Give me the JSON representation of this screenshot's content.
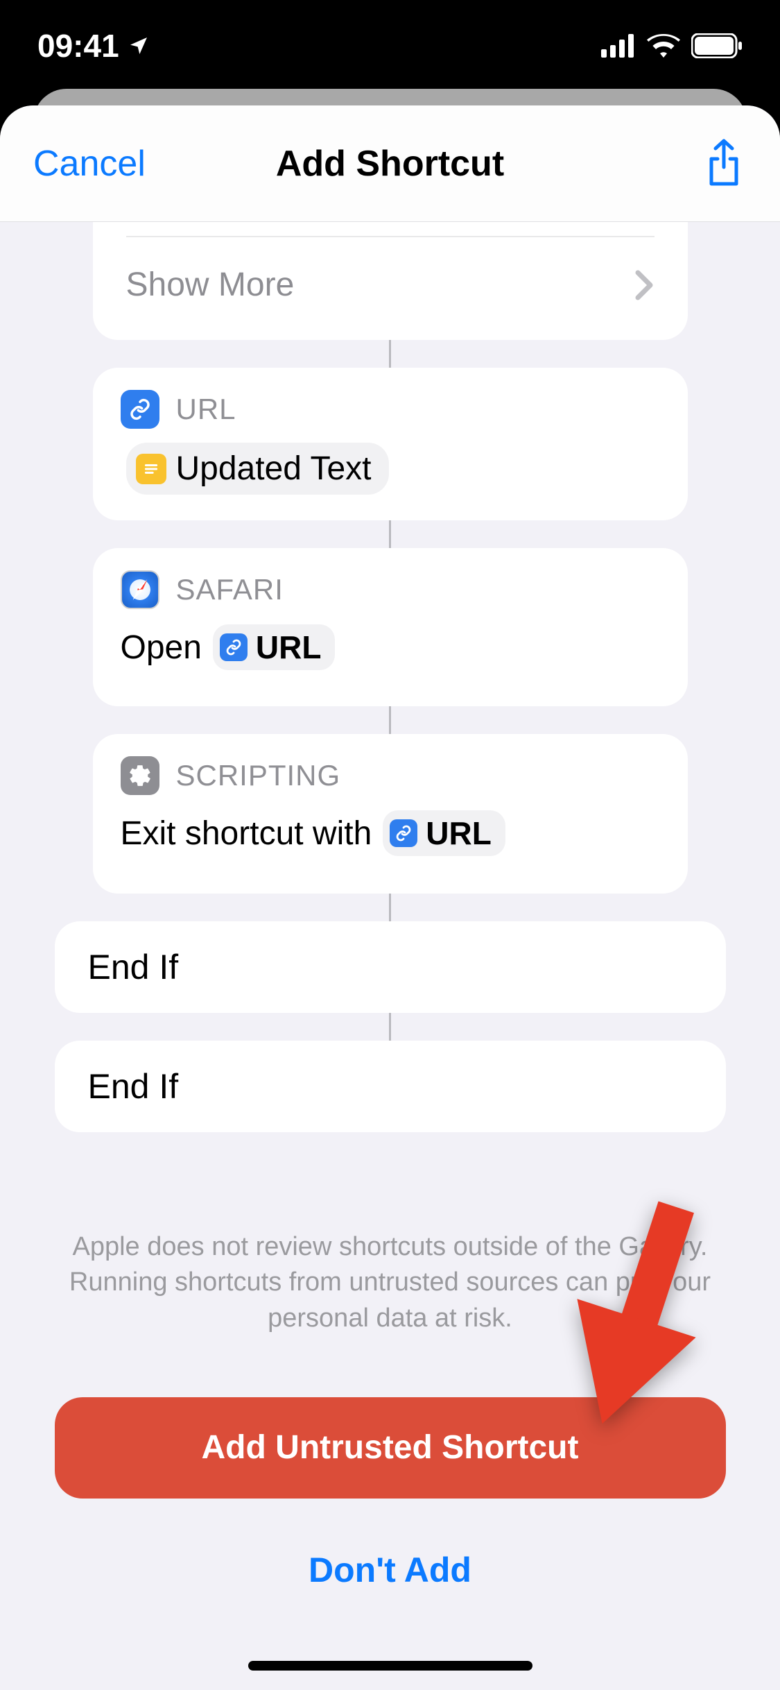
{
  "status": {
    "time": "09:41"
  },
  "header": {
    "cancel": "Cancel",
    "title": "Add Shortcut"
  },
  "show_more": "Show More",
  "cards": {
    "url": {
      "label": "URL",
      "pill_text": "Updated Text"
    },
    "safari": {
      "label": "SAFARI",
      "action": "Open",
      "pill_text": "URL"
    },
    "scripting": {
      "label": "SCRIPTING",
      "action": "Exit shortcut with",
      "pill_text": "URL"
    },
    "endif1": "End If",
    "endif2": "End If"
  },
  "disclaimer": "Apple does not review shortcuts outside of the Gallery. Running shortcuts from untrusted sources can put your personal data at risk.",
  "buttons": {
    "add": "Add Untrusted Shortcut",
    "dont_add": "Don't Add"
  }
}
